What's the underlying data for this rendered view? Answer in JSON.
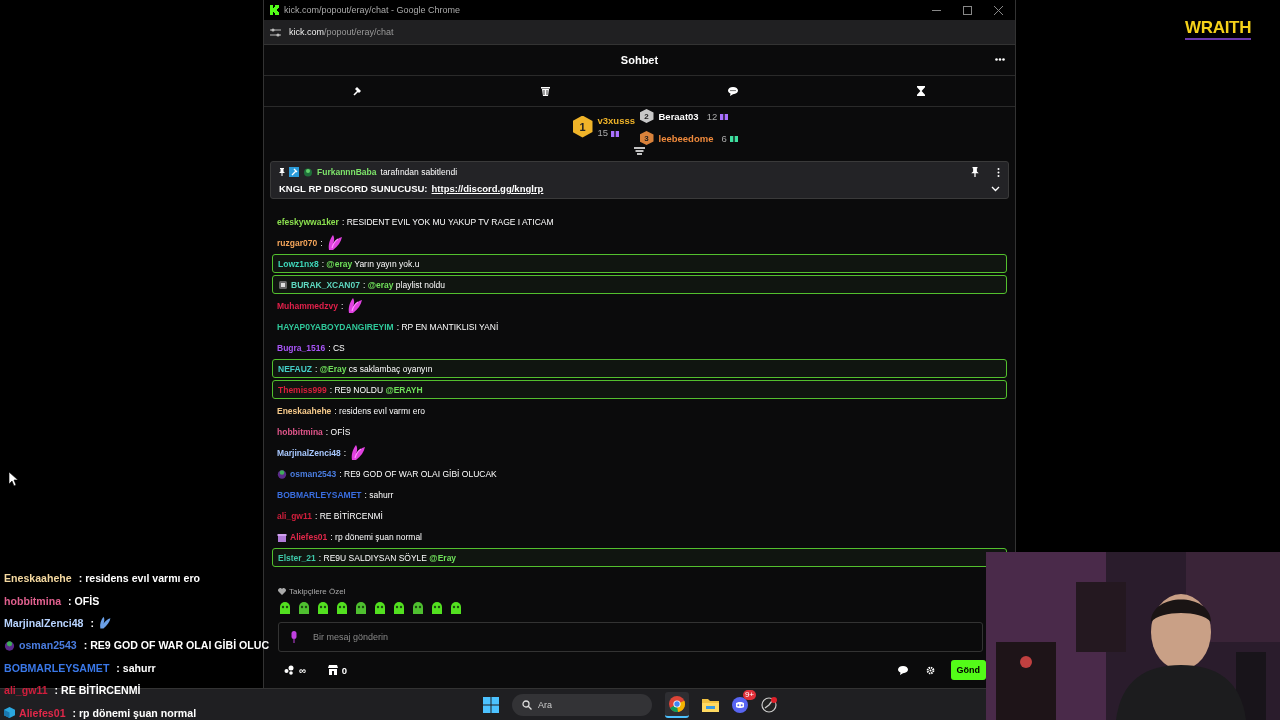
{
  "browser": {
    "title": "kick.com/popout/eray/chat - Google Chrome",
    "url_host": "kick.com",
    "url_path": "/popout/eray/chat"
  },
  "logo": "WRAITH",
  "chat": {
    "title": "Sohbet",
    "leaderboard": [
      {
        "rank": "1",
        "user": "v3xusss",
        "count": "15",
        "color": "#f0b429",
        "kind": "gift"
      },
      {
        "rank": "2",
        "user": "Beraat03",
        "count": "12",
        "color": "#ffffff",
        "kind": "gift"
      },
      {
        "rank": "3",
        "user": "leebeedome",
        "count": "6",
        "color": "#f08a3c",
        "kind": "subscription"
      }
    ],
    "pinned": {
      "user": "FurkannnBaba",
      "suffix": "tarafından sabitlendi",
      "text": "KNGL RP DISCORD SUNUCUSU:",
      "link": "https://discord.gg/knglrp"
    },
    "messages": [
      {
        "user": "efeskywwa1ker",
        "color": "#8be04f",
        "highlighted": false,
        "parts": [
          {
            "kind": "text",
            "text": ": RESIDENT EVIL YOK MU YAKUP TV RAGE I ATICAM"
          }
        ]
      },
      {
        "user": "ruzgar070",
        "color": "#f5a55a",
        "highlighted": false,
        "parts": [
          {
            "kind": "text",
            "text": ":"
          },
          {
            "kind": "emote"
          }
        ]
      },
      {
        "user": "Lowz1nx8",
        "color": "#3ed6b9",
        "highlighted": true,
        "parts": [
          {
            "kind": "text",
            "text": ":"
          },
          {
            "kind": "mention",
            "text": "@eray"
          },
          {
            "kind": "text",
            "text": "Yarın yayın yok.u"
          }
        ]
      },
      {
        "user": "BURAK_XCAN07",
        "color": "#5ed8c0",
        "highlighted": true,
        "badge": {
          "kind": "box"
        },
        "parts": [
          {
            "kind": "text",
            "text": ":"
          },
          {
            "kind": "mention",
            "text": "@eray"
          },
          {
            "kind": "text",
            "text": "playlist noldu"
          }
        ]
      },
      {
        "user": "Muhammedzvy",
        "color": "#e0204a",
        "highlighted": false,
        "parts": [
          {
            "kind": "text",
            "text": ":"
          },
          {
            "kind": "emote"
          }
        ]
      },
      {
        "user": "HAYAP0YABOYDANGIREYIM",
        "color": "#2fc89a",
        "highlighted": false,
        "parts": [
          {
            "kind": "text",
            "text": ": RP EN MANTIKLISI YANİ"
          }
        ]
      },
      {
        "user": "Bugra_1516",
        "color": "#a855f7",
        "highlighted": false,
        "parts": [
          {
            "kind": "text",
            "text": ": CS"
          }
        ]
      },
      {
        "user": "NEFAUZ",
        "color": "#45d0c8",
        "highlighted": true,
        "parts": [
          {
            "kind": "text",
            "text": ":"
          },
          {
            "kind": "mention",
            "text": "@Eray"
          },
          {
            "kind": "text",
            "text": "cs saklambaç oyanyın"
          }
        ]
      },
      {
        "user": "Themiss999",
        "color": "#d81e3c",
        "highlighted": true,
        "parts": [
          {
            "kind": "text",
            "text": ": RE9 NOLDU"
          },
          {
            "kind": "mention",
            "text": "@ERAYH"
          }
        ]
      },
      {
        "user": "Eneskaahehe",
        "color": "#f5c98a",
        "highlighted": false,
        "parts": [
          {
            "kind": "text",
            "text": ": residens evıl varmı ero"
          }
        ]
      },
      {
        "user": "hobbitmina",
        "color": "#e0558a",
        "highlighted": false,
        "parts": [
          {
            "kind": "text",
            "text": ": OFİS"
          }
        ]
      },
      {
        "user": "MarjinalZenci48",
        "color": "#a8c8ff",
        "highlighted": false,
        "parts": [
          {
            "kind": "text",
            "text": ":"
          },
          {
            "kind": "emote"
          }
        ]
      },
      {
        "user": "osman2543",
        "color": "#4a7de0",
        "highlighted": false,
        "badge": {
          "kind": "blob"
        },
        "parts": [
          {
            "kind": "text",
            "text": ": RE9 GOD OF WAR OLAI GİBİ OLUCAK"
          }
        ]
      },
      {
        "user": "BOBMARLEYSAMET",
        "color": "#3a6ee0",
        "highlighted": false,
        "parts": [
          {
            "kind": "text",
            "text": ": sahurr"
          }
        ]
      },
      {
        "user": "ali_gw11",
        "color": "#d01e3c",
        "highlighted": false,
        "parts": [
          {
            "kind": "text",
            "text": ": RE BİTİRCENMİ"
          }
        ]
      },
      {
        "user": "Aliefes01",
        "color": "#e0284a",
        "highlighted": false,
        "badge": {
          "kind": "gift"
        },
        "parts": [
          {
            "kind": "text",
            "text": ": rp dönemi şuan normal"
          }
        ]
      },
      {
        "user": "Elster_21",
        "color": "#3ec8a8",
        "highlighted": true,
        "parts": [
          {
            "kind": "text",
            "text": ": RE9U SALDIYSAN SÖYLE"
          },
          {
            "kind": "mention",
            "text": "@Eray"
          }
        ]
      }
    ],
    "emote_section": "Takipçilere Özel",
    "input": {
      "placeholder": "Bir mesaj gönderin"
    },
    "community_count": "∞",
    "store_count": "0",
    "send_button": "Gönd"
  },
  "overlay_chat": [
    {
      "user": "Eneskaahehe",
      "color": "#f5d9a0",
      "text": ": residens evıl varmı ero",
      "emote": false
    },
    {
      "user": "hobbitmina",
      "color": "#e0608e",
      "text": ": OFİS",
      "emote": false
    },
    {
      "user": "MarjinalZenci48",
      "color": "#b8d4ff",
      "text": ":",
      "emote": true
    },
    {
      "user": "osman2543",
      "color": "#4a7de0",
      "badge": {
        "kind": "blob"
      },
      "text": ": RE9 GOD OF WAR OLAI GİBİ OLUC",
      "emote": false
    },
    {
      "user": "BOBMARLEYSAMET",
      "color": "#3a78e8",
      "text": ": sahurr",
      "emote": false
    },
    {
      "user": "ali_gw11",
      "color": "#d01e3c",
      "text": ": RE BİTİRCENMİ",
      "emote": false
    },
    {
      "user": "Aliefes01",
      "color": "#e0284a",
      "badge": {
        "kind": "cube"
      },
      "text": ": rp dönemi şuan normal",
      "emote": false
    }
  ],
  "taskbar": {
    "search_placeholder": "Ara",
    "discord_badge": "9+"
  }
}
